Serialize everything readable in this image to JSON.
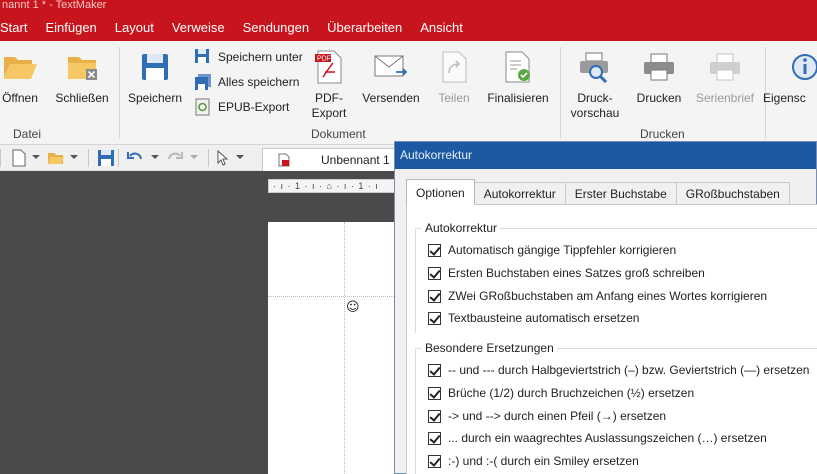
{
  "app": {
    "title": "nannt 1 * - TextMaker"
  },
  "menu": [
    "Start",
    "Einfügen",
    "Layout",
    "Verweise",
    "Sendungen",
    "Überarbeiten",
    "Ansicht"
  ],
  "ribbon": {
    "file_group": {
      "label": "Datei",
      "open": "Öffnen",
      "close": "Schließen"
    },
    "document_group": {
      "label": "Dokument",
      "save": "Speichern",
      "save_as": "Speichern unter",
      "save_all": "Alles speichern",
      "epub": "EPUB-Export",
      "pdf_line1": "PDF-",
      "pdf_line2": "Export",
      "send": "Versenden",
      "share": "Teilen",
      "finalize": "Finalisieren"
    },
    "print_group": {
      "label": "Drucken",
      "preview_line1": "Druck-",
      "preview_line2": "vorschau",
      "print": "Drucken",
      "mail_merge": "Serienbrief"
    },
    "properties": "Eigensc"
  },
  "document_tab": {
    "name": "Unbennant 1"
  },
  "ruler": {
    "text": "· ı · 1 · ı · ⌂ · ı · 1 · ı"
  },
  "page": {
    "smiley": "☺"
  },
  "dialog": {
    "title": "Autokorrektur",
    "tabs": [
      "Optionen",
      "Autokorrektur",
      "Erster Buchstabe",
      "GRoßbuchstaben"
    ],
    "active_tab": "Optionen",
    "autocorrect_section": {
      "legend": "Autokorrektur",
      "options": [
        {
          "label": "Automatisch gängige Tippfehler korrigieren",
          "checked": true
        },
        {
          "label": "Ersten Buchstaben eines Satzes groß schreiben",
          "checked": true
        },
        {
          "label": "ZWei GRoßbuchstaben am Anfang eines Wortes korrigieren",
          "checked": true
        },
        {
          "label": "Textbausteine automatisch ersetzen",
          "checked": true
        }
      ]
    },
    "replacements_section": {
      "legend": "Besondere Ersetzungen",
      "options": [
        {
          "label": "-- und --- durch Halbgeviertstrich (–) bzw. Geviertstrich (—) ersetzen",
          "checked": true
        },
        {
          "label": "Brüche (1/2) durch Bruchzeichen (½) ersetzen",
          "checked": true
        },
        {
          "label": "-> und --> durch einen Pfeil (→) ersetzen",
          "checked": true
        },
        {
          "label": "... durch ein waagrechtes Auslassungszeichen (…) ersetzen",
          "checked": true
        },
        {
          "label": ":-) und :-( durch ein Smiley ersetzen",
          "checked": true
        }
      ]
    }
  },
  "colors": {
    "accent": "#c8141c",
    "dialog_title": "#1b5aa3"
  }
}
